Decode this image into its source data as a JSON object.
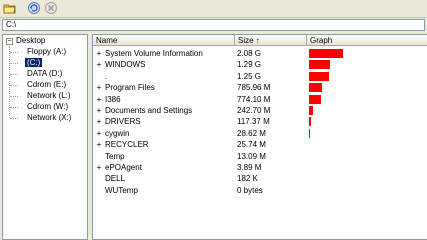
{
  "toolbar": {
    "buttons": [
      {
        "icon": "open-folder-icon"
      },
      {
        "icon": "refresh-icon"
      },
      {
        "icon": "stop-icon"
      }
    ]
  },
  "path": "C:\\",
  "tree": {
    "root": "Desktop",
    "drives": [
      "Floppy (A:)",
      "(C:)",
      "DATA (D:)",
      "Cdrom (E:)",
      "Network (L:)",
      "Cdrom (W:)",
      "Network (X:)"
    ],
    "selected_index": 1
  },
  "list": {
    "columns": {
      "name": "Name",
      "size": "Size ↑",
      "graph": "Graph"
    },
    "rows": [
      {
        "expander": "+",
        "name": "System Volume Information",
        "size": "2.08 G",
        "fraction": 1.0
      },
      {
        "expander": "+",
        "name": "WINDOWS",
        "size": "1.29 G",
        "fraction": 0.62
      },
      {
        "expander": "",
        "name": ".",
        "size": "1.25 G",
        "fraction": 0.6
      },
      {
        "expander": "+",
        "name": "Program Files",
        "size": "785.96 M",
        "fraction": 0.37
      },
      {
        "expander": "+",
        "name": "I386",
        "size": "774.10 M",
        "fraction": 0.36
      },
      {
        "expander": "+",
        "name": "Documents and Settings",
        "size": "242.70 M",
        "fraction": 0.11
      },
      {
        "expander": "+",
        "name": "DRIVERS",
        "size": "117.37 M",
        "fraction": 0.06
      },
      {
        "expander": "+",
        "name": "cygwin",
        "size": "28.62 M",
        "fraction": 0.015
      },
      {
        "expander": "+",
        "name": "RECYCLER",
        "size": "25.74 M",
        "fraction": 0.012
      },
      {
        "expander": "",
        "name": "Temp",
        "size": "13.09 M",
        "fraction": 0.006
      },
      {
        "expander": "+",
        "name": "ePOAgent",
        "size": "3.89 M",
        "fraction": 0.002
      },
      {
        "expander": "",
        "name": "DELL",
        "size": "182 K",
        "fraction": 0
      },
      {
        "expander": "",
        "name": "WUTemp",
        "size": "0 bytes",
        "fraction": 0
      }
    ]
  },
  "colors": {
    "bar": "#ff0000",
    "selection": "#0a246a"
  }
}
